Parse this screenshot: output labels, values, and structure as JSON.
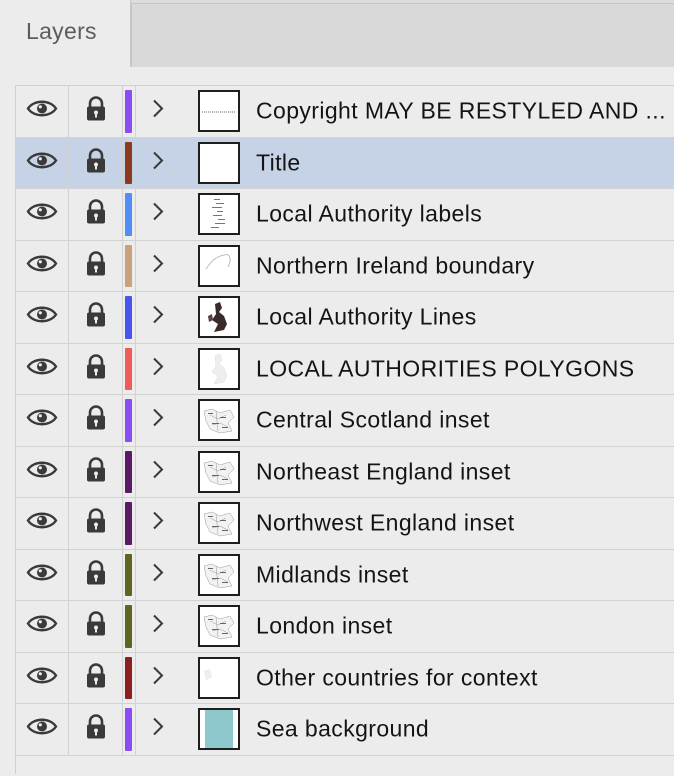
{
  "panel": {
    "tab_label": "Layers"
  },
  "layers": [
    {
      "name": "Copyright MAY BE RESTYLED AND ...",
      "color": "#8a4cf5",
      "thumb": "line"
    },
    {
      "name": "Title",
      "color": "#8b3a1e",
      "thumb": "blank",
      "selected": true
    },
    {
      "name": "Local Authority labels",
      "color": "#4f8ef5",
      "thumb": "labels"
    },
    {
      "name": "Northern Ireland boundary",
      "color": "#c9a27a",
      "thumb": "outline"
    },
    {
      "name": "Local Authority Lines",
      "color": "#4a55f0",
      "thumb": "dark-map"
    },
    {
      "name": "LOCAL AUTHORITIES POLYGONS",
      "color": "#f05a5a",
      "thumb": "faint-map"
    },
    {
      "name": "Central Scotland inset",
      "color": "#8a4cf5",
      "thumb": "inset"
    },
    {
      "name": "Northeast England inset",
      "color": "#5b1a66",
      "thumb": "inset"
    },
    {
      "name": "Northwest England inset",
      "color": "#5b1a66",
      "thumb": "inset"
    },
    {
      "name": "Midlands inset",
      "color": "#5f6420",
      "thumb": "inset"
    },
    {
      "name": "London inset",
      "color": "#5f6420",
      "thumb": "inset"
    },
    {
      "name": "Other countries for context",
      "color": "#8b1e1e",
      "thumb": "faint-shape"
    },
    {
      "name": "Sea background",
      "color": "#8a4cf5",
      "thumb": "sea"
    }
  ],
  "colors": {
    "selected_row": "#c6d3e7",
    "sea": "#8fc8cc"
  },
  "icons": {
    "visibility": "eye-icon",
    "lock": "lock-icon",
    "expand": "chevron-right-icon"
  }
}
